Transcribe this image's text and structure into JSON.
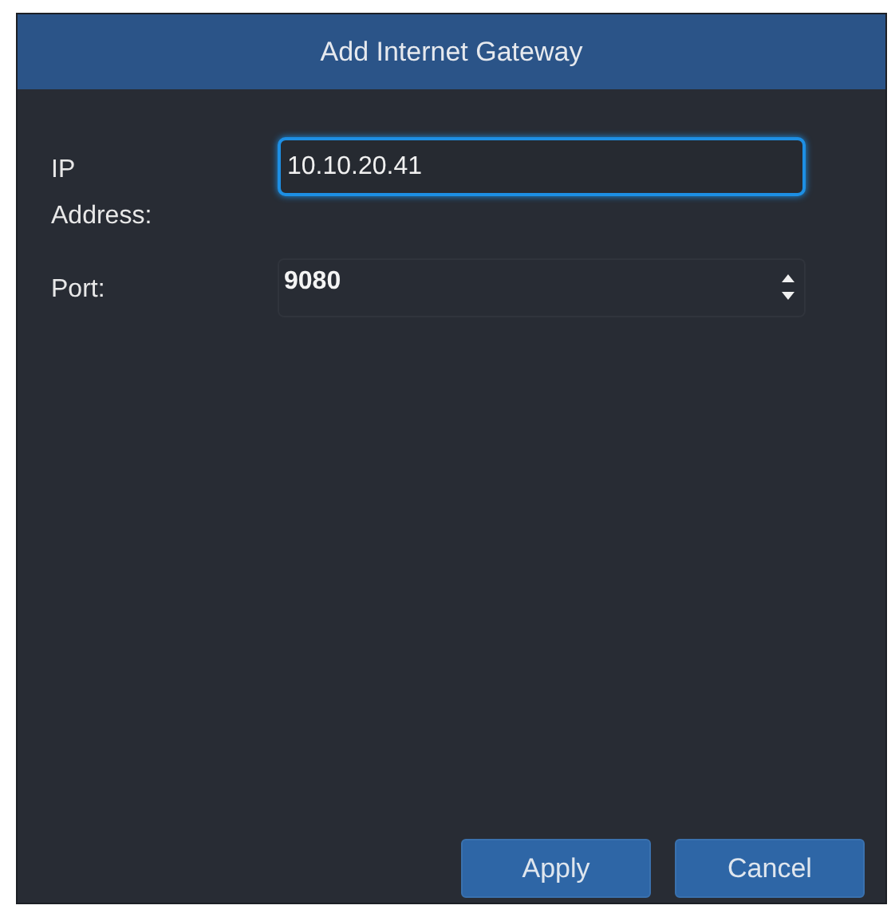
{
  "window": {
    "title": "Add Internet Gateway"
  },
  "fields": [
    {
      "kind": "text",
      "label": "IP Address:",
      "value": "10.10.20.41",
      "focused": true
    },
    {
      "kind": "number",
      "label": "Port:",
      "value": "9080",
      "focused": false
    }
  ],
  "buttons": [
    "Apply",
    "Cancel"
  ]
}
